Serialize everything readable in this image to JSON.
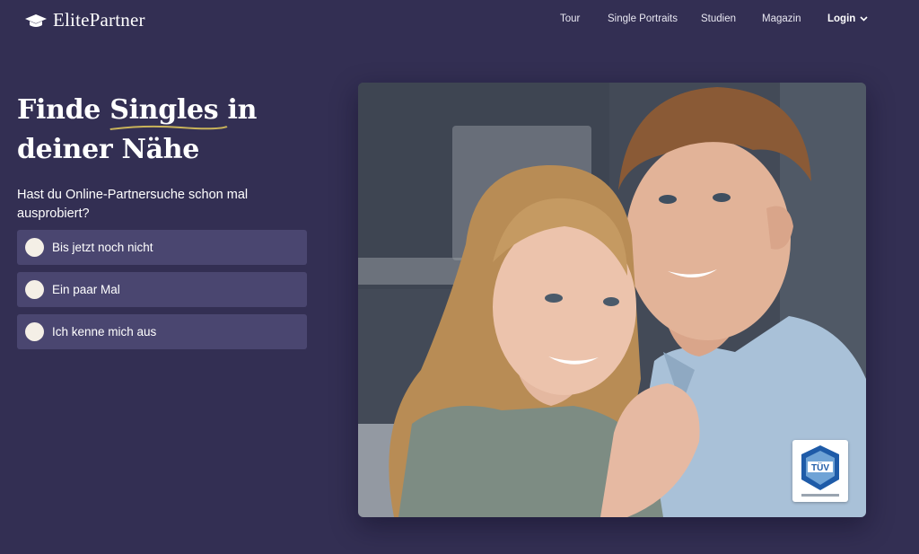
{
  "header": {
    "logo_text": "ElitePartner",
    "nav": [
      {
        "label": "Tour"
      },
      {
        "label": "Single Portraits"
      },
      {
        "label": "Studien"
      },
      {
        "label": "Magazin"
      }
    ],
    "login_label": "Login"
  },
  "hero": {
    "headline_before": "Finde ",
    "headline_highlight": "Singles",
    "headline_after": " in deiner Nähe",
    "question": "Hast du Online-Partnersuche schon mal ausprobiert?",
    "options": [
      {
        "label": "Bis jetzt noch nicht"
      },
      {
        "label": "Ein paar Mal"
      },
      {
        "label": "Ich kenne mich aus"
      }
    ]
  },
  "badge": {
    "text": "TÜV"
  },
  "colors": {
    "background": "#332f53",
    "option_bg": "#4a4670",
    "radio": "#f4efe6",
    "underline_accent": "#c9b35a"
  }
}
